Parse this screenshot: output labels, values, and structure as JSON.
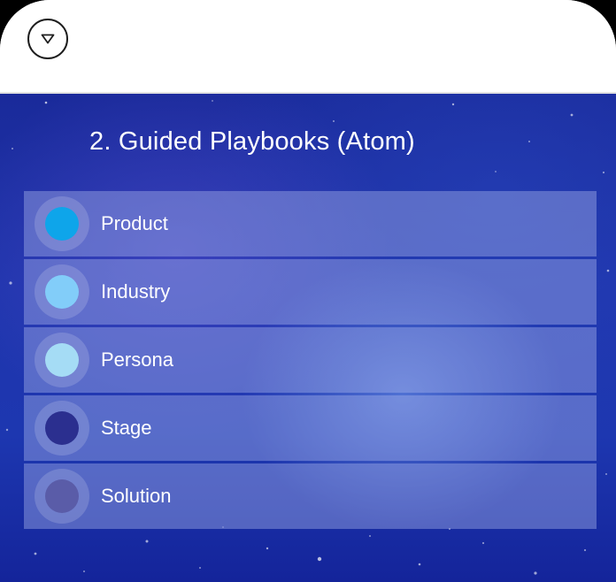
{
  "header": {
    "collapse_icon": "chevron-down-icon"
  },
  "main": {
    "title": "2. Guided Playbooks (Atom)",
    "items": [
      {
        "label": "Product",
        "dot_color": "#0ea5ea"
      },
      {
        "label": "Industry",
        "dot_color": "#82cdf9"
      },
      {
        "label": "Persona",
        "dot_color": "#a5dcf5"
      },
      {
        "label": "Stage",
        "dot_color": "#2b2f8f"
      },
      {
        "label": "Solution",
        "dot_color": "#5a5ca8"
      }
    ]
  },
  "theme": {
    "background_top": "#1a2a9a",
    "background_bottom": "#14249a",
    "row_tint": "#aab4eb",
    "text": "#ffffff"
  }
}
